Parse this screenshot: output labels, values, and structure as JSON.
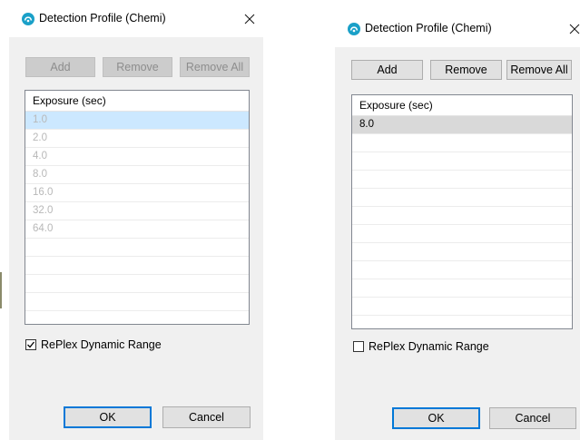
{
  "left_dialog": {
    "title": "Detection Profile (Chemi)",
    "buttons": {
      "add": "Add",
      "remove": "Remove",
      "remove_all": "Remove All"
    },
    "column_header": "Exposure (sec)",
    "rows": [
      "1.0",
      "2.0",
      "4.0",
      "8.0",
      "16.0",
      "32.0",
      "64.0"
    ],
    "selected_row": "1.0",
    "checkbox_label": "RePlex Dynamic Range",
    "checkbox_checked": true,
    "ok": "OK",
    "cancel": "Cancel"
  },
  "right_dialog": {
    "title": "Detection Profile (Chemi)",
    "buttons": {
      "add": "Add",
      "remove": "Remove",
      "remove_all": "Remove All"
    },
    "column_header": "Exposure (sec)",
    "rows": [
      "8.0"
    ],
    "selected_row": "8.0",
    "checkbox_label": "RePlex Dynamic Range",
    "checkbox_checked": false,
    "ok": "OK",
    "cancel": "Cancel"
  },
  "colors": {
    "dialog_bg": "#f0f0f0",
    "titlebar_bg": "#ffffff",
    "accent": "#0078d7",
    "icon": "#1aa0c8",
    "selection": "#cce8ff"
  }
}
